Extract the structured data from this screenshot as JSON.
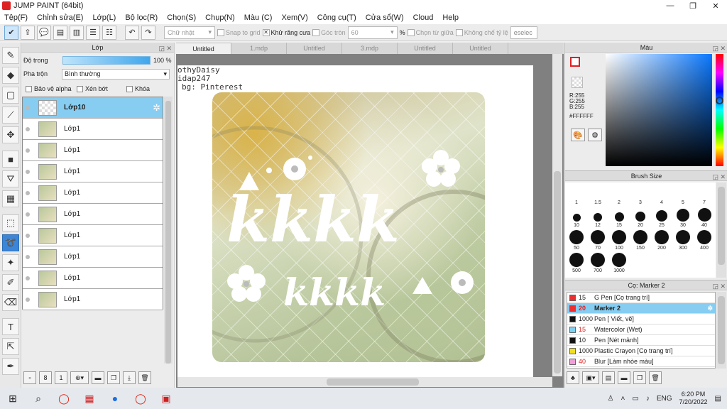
{
  "window": {
    "title": "JUMP PAINT (64bit)"
  },
  "menu": [
    "Tệp(F)",
    "Chỉnh sửa(E)",
    "Lớp(L)",
    "Bộ lọc(R)",
    "Chọn(S)",
    "Chụp(N)",
    "Màu (C)",
    "Xem(V)",
    "Công cụ(T)",
    "Cửa sổ(W)",
    "Cloud",
    "Help"
  ],
  "toolbar": {
    "shape_select": "Chữ nhật",
    "snap_grid": "Snap to grid",
    "antialias": "Khử răng cưa",
    "corner": "Góc tròn",
    "corner_value": "60",
    "percent": "%",
    "from_center": "Chọn từ giữa",
    "no_ratio": "Không chế tỷ lệ",
    "deselect": "eselec"
  },
  "layer_panel": {
    "title": "Lớp",
    "opacity_label": "Độ trong",
    "opacity_value": "100 %",
    "opacity": 1.0,
    "blend_label": "Pha trộn",
    "blend_value": "Bình thường",
    "protect_alpha": "Bảo vệ alpha",
    "clipping": "Xén bớt",
    "lock": "Khóa",
    "layers": [
      "Lớp10",
      "Lớp1",
      "Lớp1",
      "Lớp1",
      "Lớp1",
      "Lớp1",
      "Lớp1",
      "Lớp1",
      "Lớp1",
      "Lớp1"
    ]
  },
  "tabs": [
    "Untitled",
    "1.mdp",
    "Untitled",
    "3.mdp",
    "Untitled",
    "Untitled"
  ],
  "canvas": {
    "watermark": [
      "othyDaisy",
      "idap247",
      "bg: Pinterest"
    ],
    "big_text": "kkkk",
    "small_text": "kkkk"
  },
  "color_panel": {
    "title": "Màu",
    "r": "R:255",
    "g": "G:255",
    "b": "B:255",
    "hex": "#FFFFFF",
    "primary": "#ffffff",
    "accent": "#e02020"
  },
  "brush_panel": {
    "title": "Brush Size",
    "sizes": [
      "1",
      "1.5",
      "2",
      "3",
      "4",
      "5",
      "7",
      "10",
      "12",
      "15",
      "20",
      "25",
      "30",
      "40",
      "50",
      "70",
      "100",
      "150",
      "200",
      "300",
      "400",
      "500",
      "700",
      "1000"
    ]
  },
  "sub_panel": {
    "title": "Cọ: Marker 2",
    "items": [
      {
        "size": "15",
        "name": "G Pen [Cọ trang trí]",
        "color": "#e83030"
      },
      {
        "size": "20",
        "name": "Marker 2",
        "color": "#e83030"
      },
      {
        "size": "1000",
        "name": "Pen [ Viết, vẽ]",
        "color": "#111111"
      },
      {
        "size": "15",
        "name": "Watercolor (Wet)",
        "color": "#7fd0f0"
      },
      {
        "size": "10",
        "name": "Pen [Nét mảnh]",
        "color": "#111111"
      },
      {
        "size": "1000",
        "name": "Plastic Crayon [Cọ trang trí]",
        "color": "#f0e020"
      },
      {
        "size": "40",
        "name": "Blur [Làm nhòe màu]",
        "color": "#f0a0d8"
      }
    ]
  },
  "taskbar": {
    "lang": "ENG",
    "time": "6:20 PM",
    "date": "7/20/2022"
  }
}
